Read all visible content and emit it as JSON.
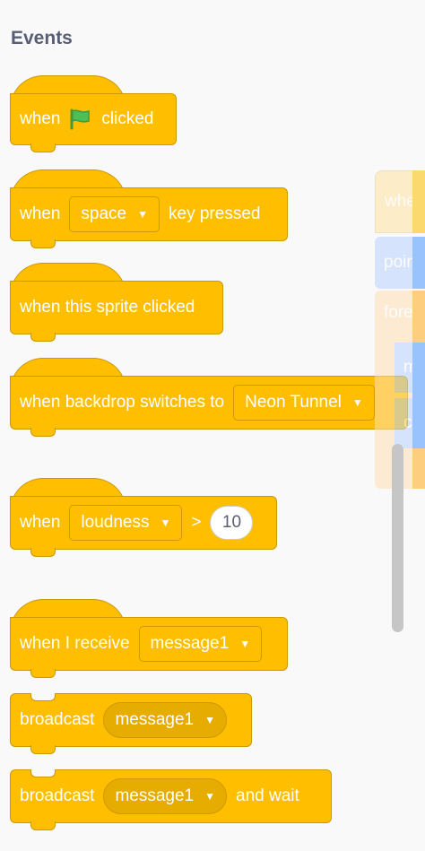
{
  "palette": {
    "title": "Events",
    "blocks": {
      "flag": {
        "when": "when",
        "clicked": "clicked"
      },
      "key": {
        "when": "when",
        "key": "space",
        "pressed": "key pressed"
      },
      "sprite": {
        "label": "when this sprite clicked"
      },
      "backdrop": {
        "label": "when backdrop switches to",
        "value": "Neon Tunnel"
      },
      "loudness": {
        "when": "when",
        "sensor": "loudness",
        "op": ">",
        "value": "10"
      },
      "receive": {
        "label": "when I receive",
        "value": "message1"
      },
      "broadcast": {
        "label": "broadcast",
        "value": "message1"
      },
      "broadcast_wait": {
        "label": "broadcast",
        "value": "message1",
        "suffix": "and wait"
      }
    }
  },
  "workspace": {
    "peek": [
      "when",
      "point",
      "forev",
      "mo",
      "c"
    ]
  },
  "colors": {
    "events": "#ffbf00",
    "events_border": "#cc9900",
    "motion": "#4c97ff",
    "control": "#ffab19"
  }
}
